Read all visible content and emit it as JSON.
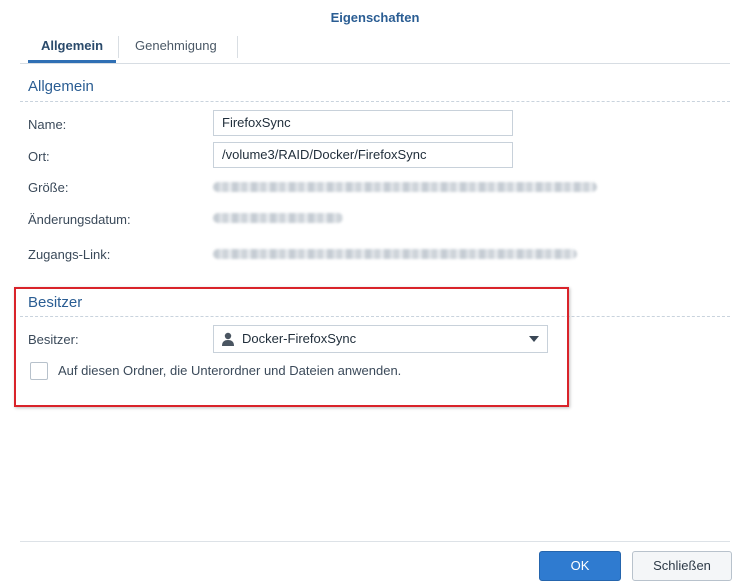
{
  "window": {
    "title": "Eigenschaften"
  },
  "tabs": [
    {
      "label": "Allgemein",
      "active": true
    },
    {
      "label": "Genehmigung",
      "active": false
    }
  ],
  "general": {
    "section_title": "Allgemein",
    "name_label": "Name:",
    "name_value": "FirefoxSync",
    "location_label": "Ort:",
    "location_value": "/volume3/RAID/Docker/FirefoxSync",
    "size_label": "Größe:",
    "modified_label": "Änderungsdatum:",
    "access_link_label": "Zugangs-Link:"
  },
  "owner": {
    "section_title": "Besitzer",
    "owner_label": "Besitzer:",
    "owner_value": "Docker-FirefoxSync",
    "owner_icon": "user-icon",
    "apply_recursive_label": "Auf diesen Ordner, die Unterordner und Dateien anwenden.",
    "apply_recursive_checked": false
  },
  "footer": {
    "ok_label": "OK",
    "close_label": "Schließen"
  },
  "colors": {
    "accent": "#2a5d93",
    "primary_button": "#2f7bd0",
    "highlight": "#d9232a"
  }
}
